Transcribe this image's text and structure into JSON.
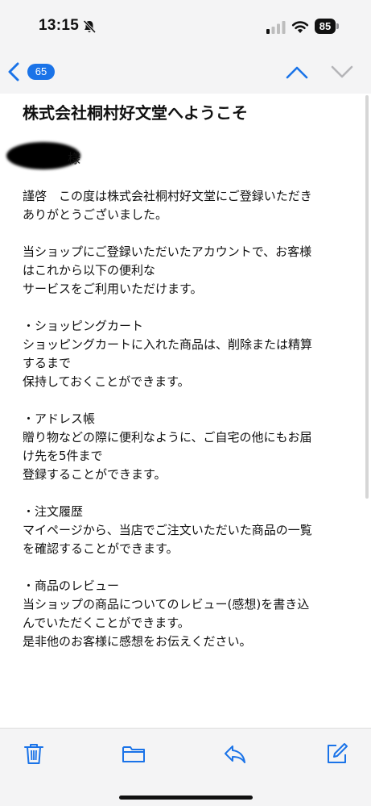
{
  "status_bar": {
    "time": "13:15",
    "battery": "85",
    "icons": [
      "bell-slash-icon",
      "cellular-signal-icon",
      "wifi-icon",
      "battery-icon"
    ]
  },
  "nav": {
    "unread_count": "65",
    "icons": [
      "chevron-left-icon",
      "chevron-up-icon",
      "chevron-down-icon"
    ],
    "accent_color": "#1a73e8"
  },
  "email": {
    "subject": "株式会社桐村好文堂へようこそ",
    "recipient_suffix": "様",
    "body_lines": [
      "謹啓　この度は株式会社桐村好文堂にご登録いただき",
      "ありがとうございました。",
      "",
      "当ショップにご登録いただいたアカウントで、お客様",
      "はこれから以下の便利な",
      "サービスをご利用いただけます。",
      "",
      "・ショッピングカート",
      "ショッピングカートに入れた商品は、削除または精算",
      "するまで",
      "保持しておくことができます。",
      "",
      "・アドレス帳",
      "贈り物などの際に便利なように、ご自宅の他にもお届",
      "け先を5件まで",
      "登録することができます。",
      "",
      "・注文履歴",
      "マイページから、当店でご注文いただいた商品の一覧",
      "を確認することができます。",
      "",
      "・商品のレビュー",
      "当ショップの商品についてのレビュー(感想)を書き込",
      "んでいただくことができます。",
      "是非他のお客様に感想をお伝えください。"
    ]
  },
  "toolbar": {
    "icons": [
      "trash-icon",
      "folder-icon",
      "reply-icon",
      "compose-icon"
    ]
  }
}
